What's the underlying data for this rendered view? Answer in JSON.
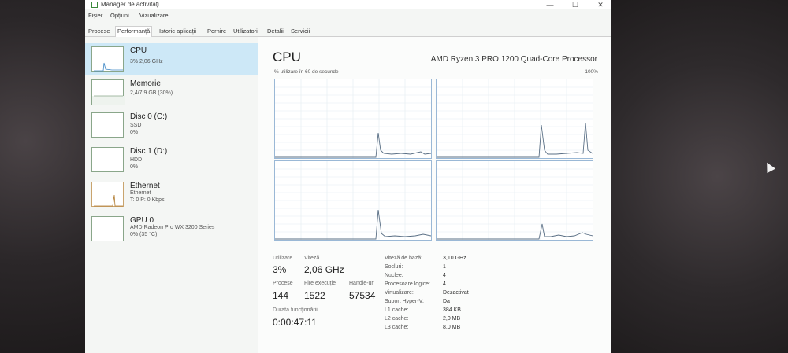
{
  "window": {
    "title": "Manager de activități"
  },
  "menu": [
    "Fișier",
    "Opțiuni",
    "Vizualizare"
  ],
  "tabs": [
    "Procese",
    "Performanță",
    "Istoric aplicații",
    "Pornire",
    "Utilizatori",
    "Detalii",
    "Servicii"
  ],
  "active_tab": "Performanță",
  "sidebar": {
    "items": [
      {
        "name": "CPU",
        "line1": "3% 2,06 GHz",
        "line2": ""
      },
      {
        "name": "Memorie",
        "line1": "2,4/7,9 GB (30%)",
        "line2": ""
      },
      {
        "name": "Disc 0 (C:)",
        "line1": "SSD",
        "line2": "0%"
      },
      {
        "name": "Disc 1 (D:)",
        "line1": "HDD",
        "line2": "0%"
      },
      {
        "name": "Ethernet",
        "line1": "Ethernet",
        "line2": "T: 0 P: 0 Kbps"
      },
      {
        "name": "GPU 0",
        "line1": "AMD Radeon Pro WX 3200 Series",
        "line2": "0% (35 °C)"
      }
    ]
  },
  "main": {
    "title": "CPU",
    "processor": "AMD Ryzen 3 PRO 1200 Quad-Core Processor",
    "graph_label": "% utilizare în 60 de secunde",
    "graph_max": "100%",
    "stats": {
      "utilizare_label": "Utilizare",
      "utilizare": "3%",
      "viteza_label": "Viteză",
      "viteza": "2,06 GHz",
      "procese_label": "Procese",
      "procese": "144",
      "fire_label": "Fire execuție",
      "fire": "1522",
      "handle_label": "Handle-uri",
      "handle": "57534",
      "durata_label": "Durata funcționării",
      "durata": "0:00:47:11"
    },
    "details": [
      {
        "label": "Viteză de bază:",
        "value": "3,10 GHz"
      },
      {
        "label": "Socluri:",
        "value": "1"
      },
      {
        "label": "Nuclee:",
        "value": "4"
      },
      {
        "label": "Procesoare logice:",
        "value": "4"
      },
      {
        "label": "Virtualizare:",
        "value": "Dezactivat"
      },
      {
        "label": "Suport Hyper-V:",
        "value": "Da"
      },
      {
        "label": "L1 cache:",
        "value": "384 KB"
      },
      {
        "label": "L2 cache:",
        "value": "2,0 MB"
      },
      {
        "label": "L3 cache:",
        "value": "8,0 MB"
      }
    ]
  },
  "colors": {
    "accent": "#1e8ad6",
    "graph_line": "#5a6f85",
    "selection": "#cde8f7"
  },
  "icons": [
    "task-manager-icon",
    "minimize-icon",
    "maximize-icon",
    "close-icon"
  ]
}
